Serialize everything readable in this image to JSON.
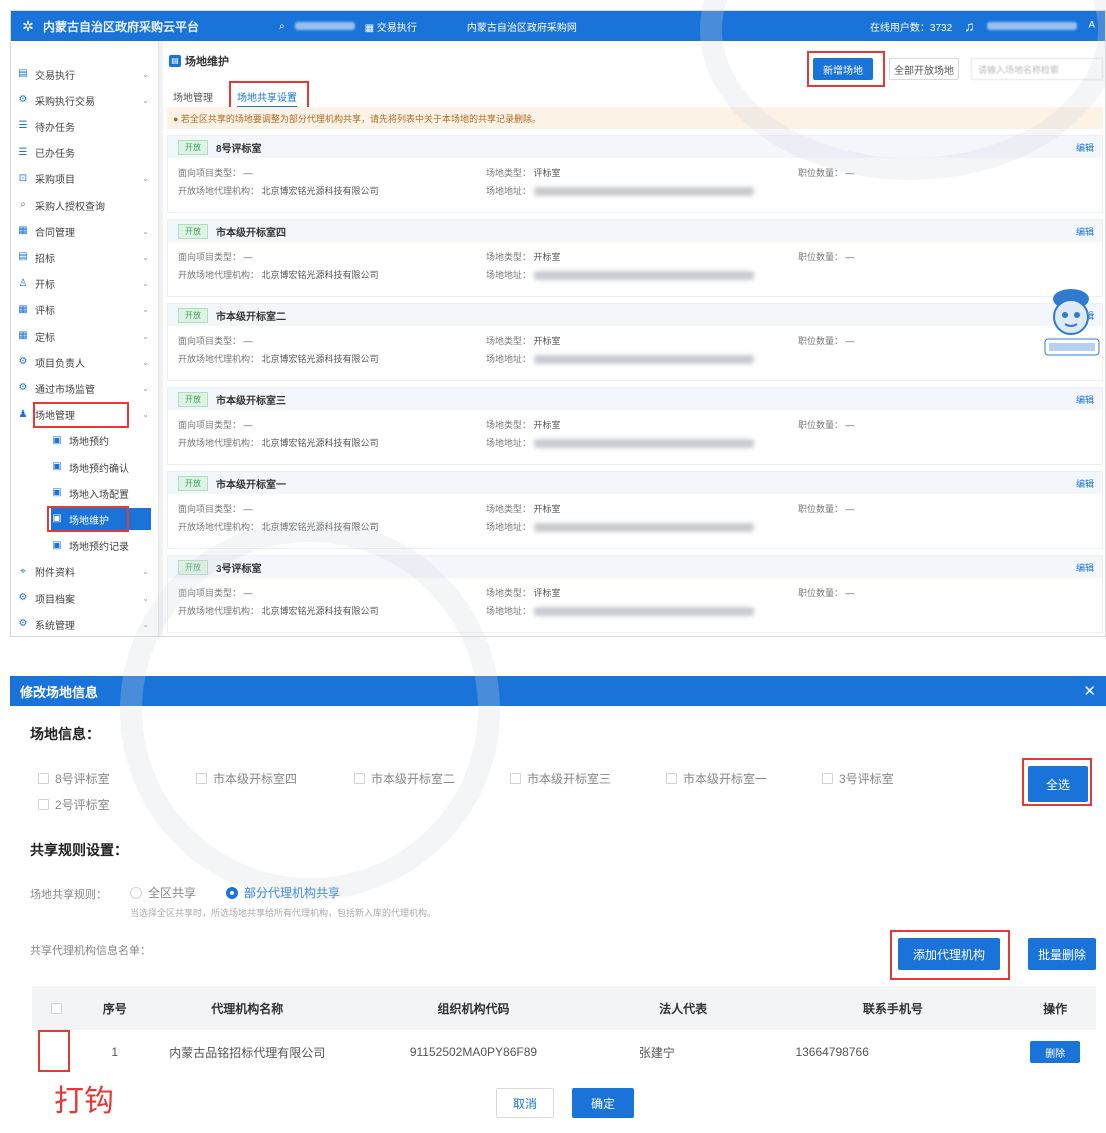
{
  "topbar": {
    "title": "内蒙古自治区政府采购云平台",
    "nav": [
      "交易执行",
      "内蒙古自治区政府采购网"
    ],
    "online_label": "在线用户数：",
    "online_count": "3732"
  },
  "sidebar": {
    "items": [
      {
        "label": "交易执行",
        "icon": "doc-icon",
        "arrow": true
      },
      {
        "label": "采购执行交易",
        "icon": "gear-icon",
        "arrow": true
      },
      {
        "label": "待办任务",
        "icon": "list-icon",
        "arrow": false
      },
      {
        "label": "已办任务",
        "icon": "list-icon",
        "arrow": false
      },
      {
        "label": "采购项目",
        "icon": "cart-icon",
        "arrow": true
      },
      {
        "label": "采购人授权查询",
        "icon": "search-icon",
        "arrow": false
      },
      {
        "label": "合同管理",
        "icon": "grid-icon",
        "arrow": true
      },
      {
        "label": "招标",
        "icon": "doc-icon",
        "arrow": true
      },
      {
        "label": "开标",
        "icon": "user-icon",
        "arrow": true
      },
      {
        "label": "评标",
        "icon": "grid-icon",
        "arrow": true
      },
      {
        "label": "定标",
        "icon": "grid-icon",
        "arrow": true
      },
      {
        "label": "项目负责人",
        "icon": "gear-icon",
        "arrow": true
      },
      {
        "label": "通过市场监管",
        "icon": "gear-icon",
        "arrow": true
      },
      {
        "label": "场地管理",
        "icon": "person-icon",
        "arrow": true
      },
      {
        "label": "场地预约",
        "icon": "calendar-icon",
        "arrow": false,
        "sub": true
      },
      {
        "label": "场地预约确认",
        "icon": "calendar-icon",
        "arrow": false,
        "sub": true
      },
      {
        "label": "场地入场配置",
        "icon": "calendar-icon",
        "arrow": false,
        "sub": true
      },
      {
        "label": "场地维护",
        "icon": "calendar-icon",
        "arrow": false,
        "sub": true,
        "active": true
      },
      {
        "label": "场地预约记录",
        "icon": "calendar-icon",
        "arrow": false,
        "sub": true
      },
      {
        "label": "附件资料",
        "icon": "clip-icon",
        "arrow": true
      },
      {
        "label": "项目档案",
        "icon": "gear-icon",
        "arrow": true
      },
      {
        "label": "系统管理",
        "icon": "gear-icon",
        "arrow": true
      }
    ]
  },
  "content": {
    "title": "场地维护",
    "tabs": [
      "场地管理",
      "场地共享设置"
    ],
    "add_button": "新增场地",
    "all_venues_button": "全部开放场地",
    "search_placeholder": "请输入场地名称检索",
    "notice": "● 若全区共享的场地要调整为部分代理机构共享，请先将列表中关于本场地的共享记录删除。",
    "tag": "开放",
    "edit": "编辑",
    "field_labels": {
      "project_type": "面向项目类型：",
      "agency": "开放场地代理机构：",
      "venue_type": "场地类型：",
      "venue_addr": "场地地址：",
      "seats": "职位数量："
    },
    "agency_value": "北京博宏铭光源科技有限公司",
    "dash": "—",
    "cards": [
      {
        "name": "8号评标室",
        "type": "评标室"
      },
      {
        "name": "市本级开标室四",
        "type": "开标室"
      },
      {
        "name": "市本级开标室二",
        "type": "开标室"
      },
      {
        "name": "市本级开标室三",
        "type": "开标室"
      },
      {
        "name": "市本级开标室一",
        "type": "开标室"
      },
      {
        "name": "3号评标室",
        "type": "评标室"
      }
    ]
  },
  "dialog": {
    "title": "修改场地信息",
    "venue_section": "场地信息：",
    "venues": [
      "8号评标室",
      "市本级开标室四",
      "市本级开标室二",
      "市本级开标室三",
      "市本级开标室一",
      "3号评标室",
      "2号评标室"
    ],
    "select_all": "全选",
    "share_section": "共享规则设置：",
    "share_rule_label": "场地共享规则：",
    "rule_all": "全区共享",
    "rule_partial": "部分代理机构共享",
    "rule_hint": "当选择全区共享时，所选场地共享给所有代理机构，包括新入库的代理机构。",
    "list_label": "共享代理机构信息名单：",
    "add_agency": "添加代理机构",
    "batch_delete": "批量删除",
    "table": {
      "headers": [
        "序号",
        "代理机构名称",
        "组织机构代码",
        "法人代表",
        "联系手机号",
        "操作"
      ],
      "rows": [
        {
          "index": "1",
          "name": "内蒙古品铭招标代理有限公司",
          "code": "91152502MA0PY86F89",
          "rep": "张建宁",
          "phone": "13664798766",
          "action": "删除"
        }
      ]
    },
    "cancel": "取消",
    "confirm": "确定"
  },
  "annotation": "打钩"
}
